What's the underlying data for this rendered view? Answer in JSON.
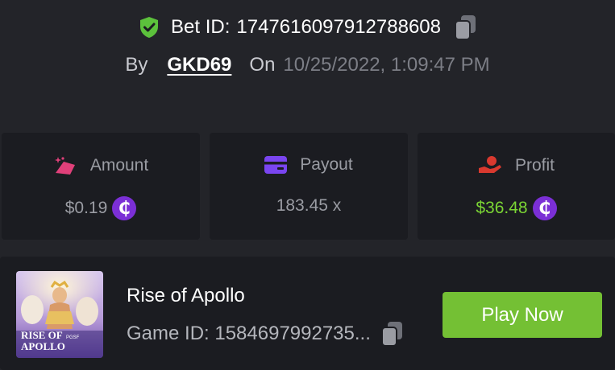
{
  "bet": {
    "label": "Bet ID:",
    "id": "1747616097912788608",
    "by_label": "By",
    "user": "GKD69",
    "on_label": "On",
    "datetime": "10/25/2022, 1:09:47 PM"
  },
  "stats": [
    {
      "label": "Amount",
      "value": "$0.19",
      "icon": "amount-icon",
      "coin": "₵"
    },
    {
      "label": "Payout",
      "value": "183.45 x",
      "icon": "wallet-icon"
    },
    {
      "label": "Profit",
      "value": "$36.48",
      "icon": "profit-hand-icon",
      "coin": "₵"
    }
  ],
  "game": {
    "title": "Rise of Apollo",
    "id_text": "Game ID: 1584697992735...",
    "play_label": "Play Now",
    "thumb_title": "RISE OF APOLLO",
    "thumb_brand": "PGSF"
  },
  "colors": {
    "background": "#232429",
    "card": "#1b1c21",
    "accent_green": "#74c034",
    "profit_green": "#7bd534",
    "coin_purple": "#7b2fd6",
    "shield_green": "#5cc13c"
  }
}
